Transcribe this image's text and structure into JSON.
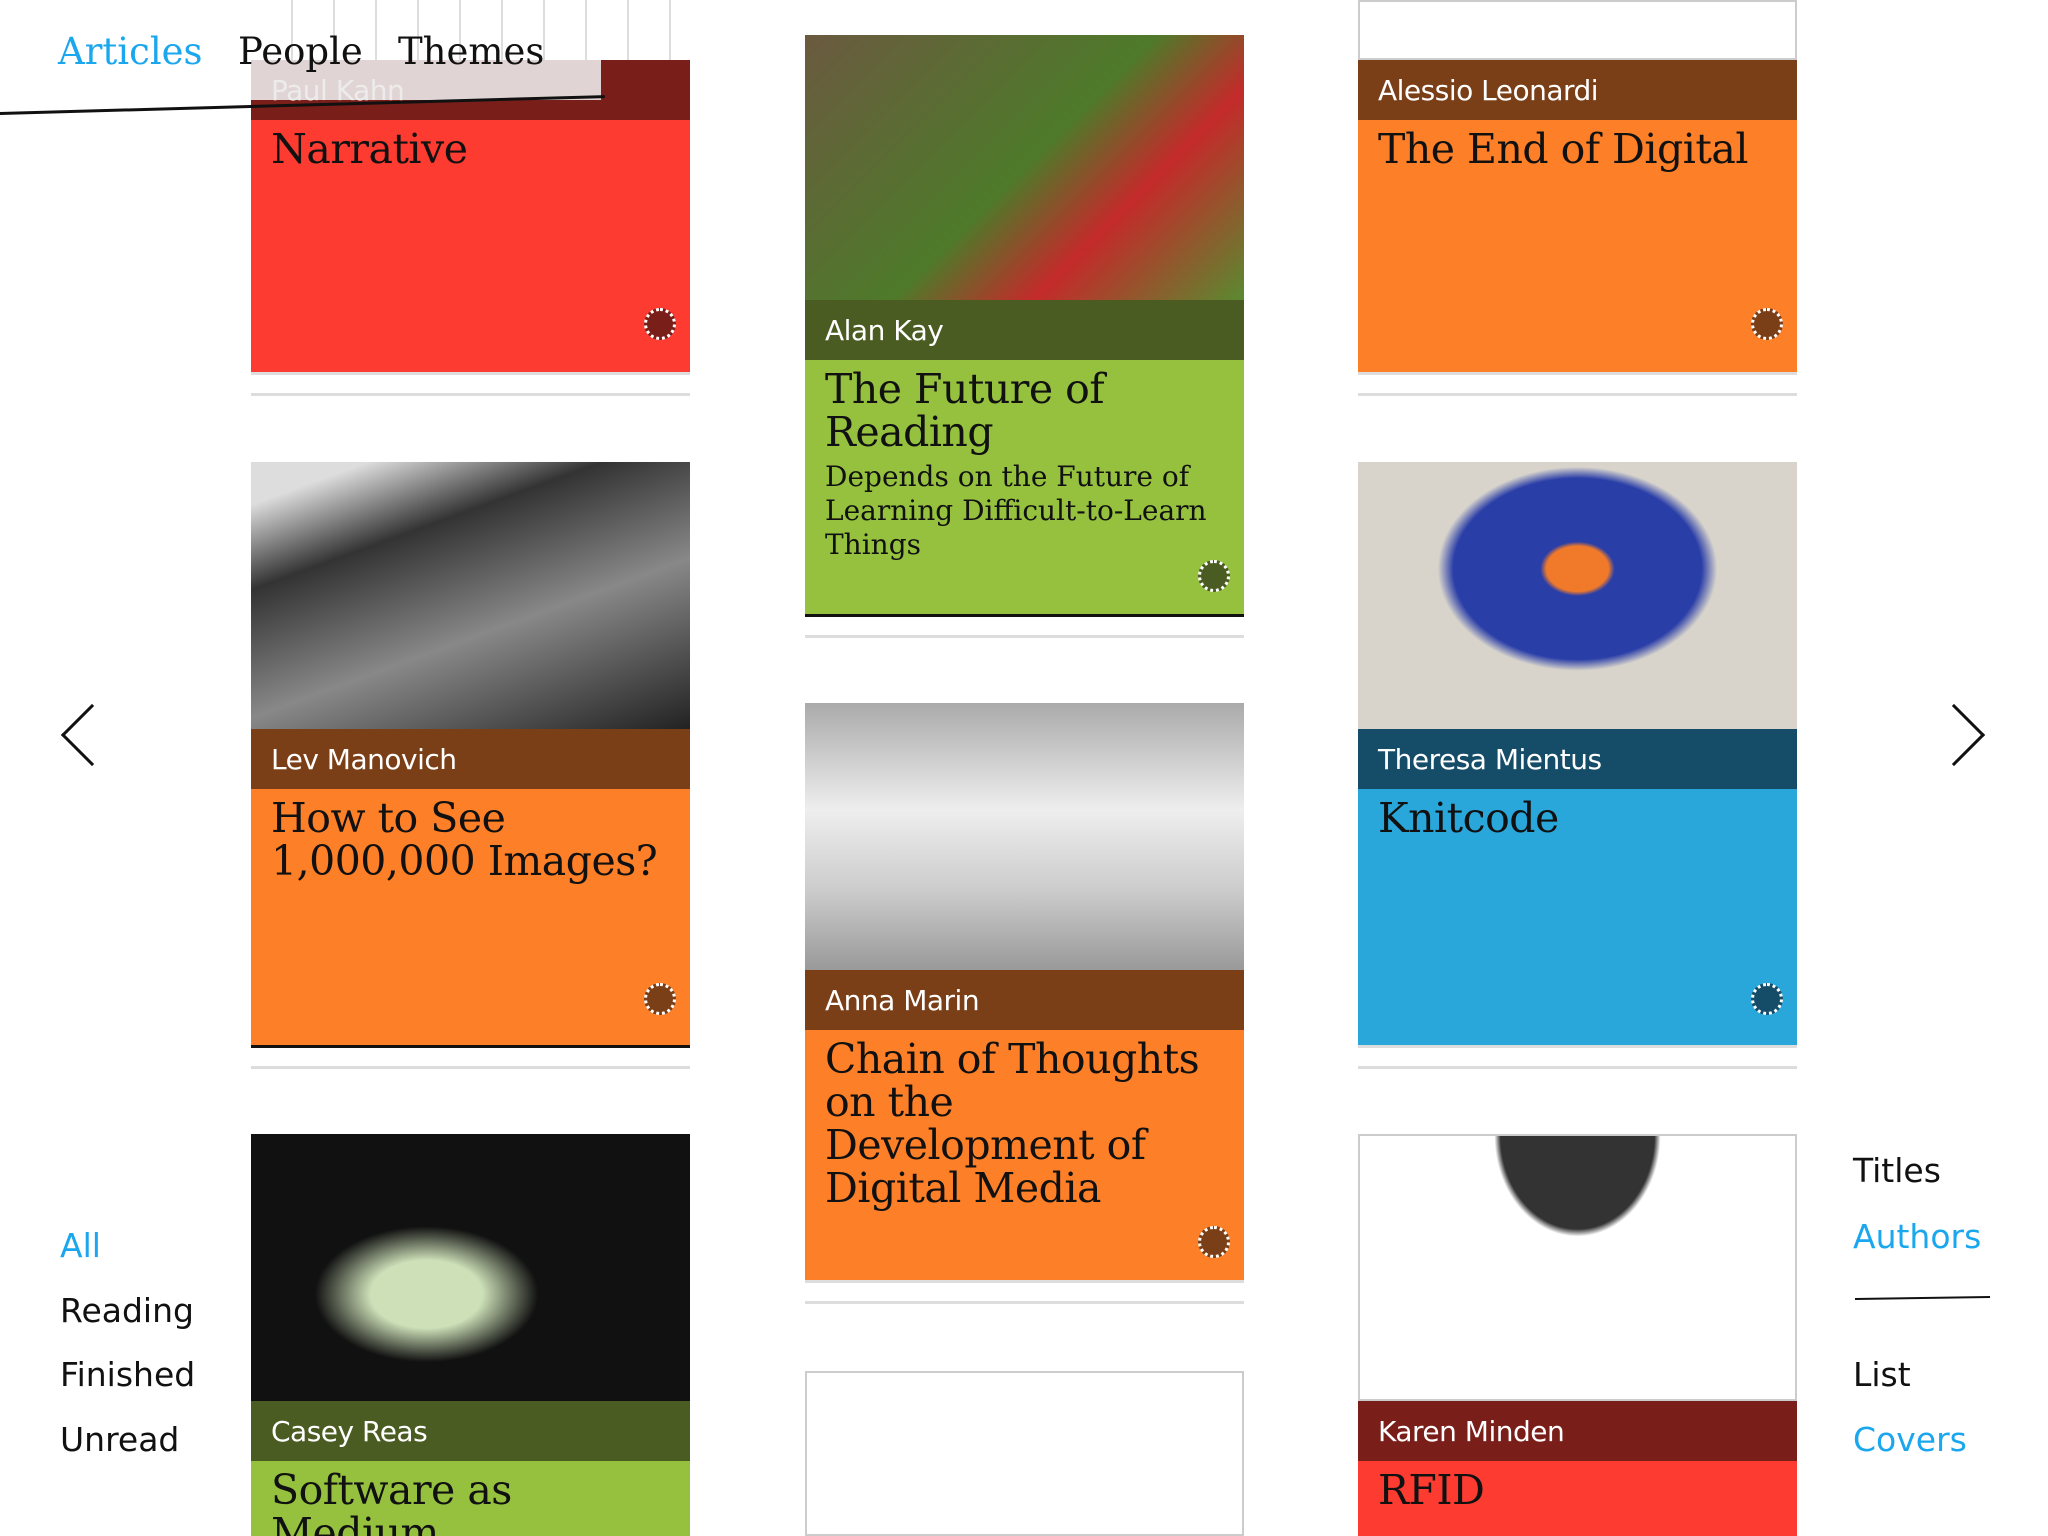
{
  "nav": {
    "tabs": [
      {
        "label": "Articles",
        "active": true
      },
      {
        "label": "People"
      },
      {
        "label": "Themes"
      }
    ]
  },
  "filters": {
    "items": [
      "All",
      "Reading",
      "Finished",
      "Unread"
    ],
    "active": "All"
  },
  "sort": {
    "items": [
      "Titles",
      "Authors"
    ],
    "active": "Authors"
  },
  "view": {
    "items": [
      "List",
      "Covers"
    ],
    "active": "Covers"
  },
  "cards": [
    {
      "author": "Paul Kahn",
      "title": "Narrative",
      "color": "#fd3b31",
      "band": "#7a1e1a"
    },
    {
      "author": "Lev Manovich",
      "title": "How to See 1,000,000 Images?",
      "color": "#fd7f27",
      "band": "#7a3f17"
    },
    {
      "author": "Casey Reas",
      "title": "Software as Medium",
      "color": "#95c13f",
      "band": "#4b5c22"
    },
    {
      "author": "Alan Kay",
      "title": "The Future of Reading",
      "subtitle": "Depends on the Future of Learning Difficult-to-Learn Things",
      "color": "#95c13f",
      "band": "#4b5c22"
    },
    {
      "author": "Anna Marin",
      "title": "Chain of Thoughts on the Development of Digital Media",
      "color": "#fd7f27",
      "band": "#7a3f17"
    },
    {
      "author": "Alessio Leonardi",
      "title": "The End of Digital",
      "color": "#fd7f27",
      "band": "#7a3f17"
    },
    {
      "author": "Theresa Mientus",
      "title": "Knitcode",
      "color": "#29a7db",
      "band": "#154c68"
    },
    {
      "author": "Karen Minden",
      "title": "RFID",
      "color": "#fd3b31",
      "band": "#7a1e1a"
    }
  ]
}
